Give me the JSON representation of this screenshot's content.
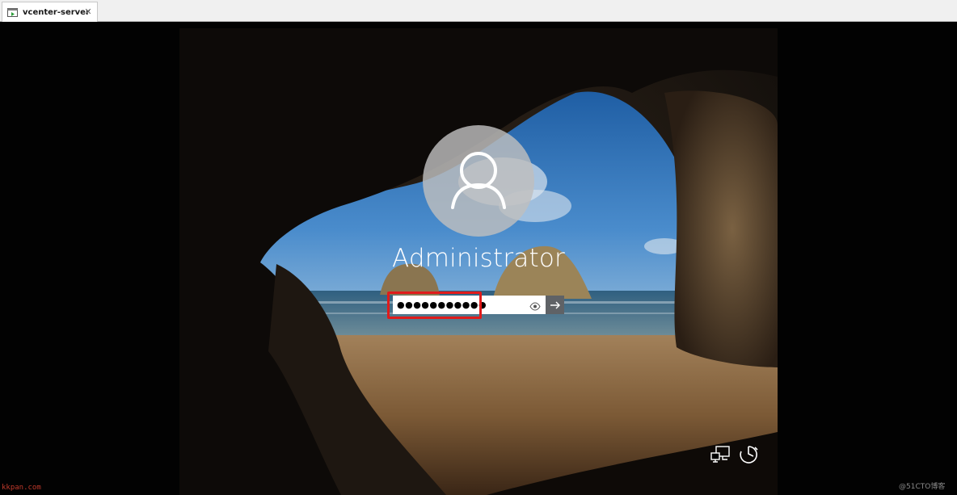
{
  "tab": {
    "label": "vcenter-server",
    "icon": "vm-console-icon",
    "close_glyph": "✕"
  },
  "login": {
    "username": "Administrator",
    "password_mask": "●●●●●●●●●●●",
    "reveal_icon": "eye-icon",
    "submit_icon": "arrow-right-icon",
    "avatar_icon": "user-icon"
  },
  "system_icons": {
    "network": "network-icon",
    "ease_of_access": "ease-of-access-icon"
  },
  "watermarks": {
    "left": "kkpan.com",
    "right": "@51CTO博客"
  },
  "colors": {
    "highlight": "#e01b1b",
    "submit_bg": "#5f6266"
  }
}
